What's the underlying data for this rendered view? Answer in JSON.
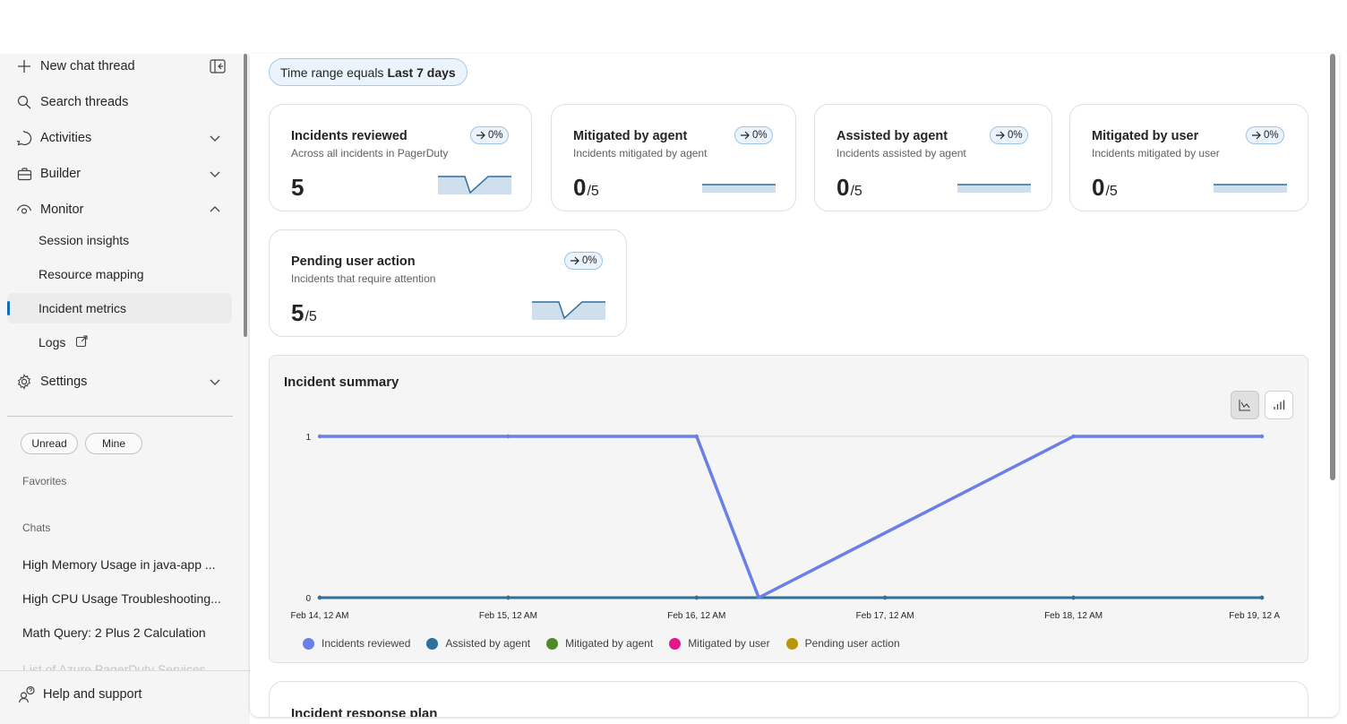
{
  "sidebar": {
    "new_chat": "New chat thread",
    "search": "Search threads",
    "activities": "Activities",
    "builder": "Builder",
    "monitor": "Monitor",
    "monitor_items": [
      "Session insights",
      "Resource mapping",
      "Incident metrics",
      "Logs"
    ],
    "settings": "Settings",
    "filters": [
      "Unread",
      "Mine"
    ],
    "favorites": "Favorites",
    "chats_title": "Chats",
    "chats": [
      "High Memory Usage in java-app ...",
      "High CPU Usage Troubleshooting...",
      "Math Query: 2 Plus 2 Calculation",
      "List of Azure PagerDuty Services"
    ],
    "help": "Help and support"
  },
  "filter": {
    "prefix": "Time range equals",
    "value": "Last 7 days"
  },
  "cards": [
    {
      "title": "Incidents reviewed",
      "subtitle": "Across all incidents in PagerDuty",
      "value": "5",
      "denominator": "",
      "trend": "0%"
    },
    {
      "title": "Mitigated by agent",
      "subtitle": "Incidents mitigated by agent",
      "value": "0",
      "denominator": "/5",
      "trend": "0%"
    },
    {
      "title": "Assisted by agent",
      "subtitle": "Incidents assisted by agent",
      "value": "0",
      "denominator": "/5",
      "trend": "0%"
    },
    {
      "title": "Mitigated by user",
      "subtitle": "Incidents mitigated by user",
      "value": "0",
      "denominator": "/5",
      "trend": "0%"
    },
    {
      "title": "Pending user action",
      "subtitle": "Incidents that require attention",
      "value": "5",
      "denominator": "/5",
      "trend": "0%"
    }
  ],
  "summary": {
    "title": "Incident summary"
  },
  "plan": {
    "title": "Incident response plan"
  },
  "colors": {
    "accent": "#0f6cbd",
    "incidents_reviewed": "#6b7fe8",
    "assisted_by_agent": "#2e6f9e",
    "mitigated_by_agent": "#4e8a2a",
    "mitigated_by_user": "#e3178b",
    "pending_user_action": "#b8960c"
  },
  "chart_data": {
    "type": "line",
    "x": [
      "Feb 14, 12 AM",
      "Feb 15, 12 AM",
      "Feb 16, 12 AM",
      "Feb 16, 8 AM",
      "Feb 17, 12 AM",
      "Feb 18, 12 AM",
      "Feb 19, 12 AM"
    ],
    "x_positions_days": [
      0,
      1,
      2,
      2.33,
      3,
      4,
      5
    ],
    "tick_labels": [
      "Feb 14, 12 AM",
      "Feb 15, 12 AM",
      "Feb 16, 12 AM",
      "Feb 17, 12 AM",
      "Feb 18, 12 AM",
      "Feb 19, 12 A"
    ],
    "yticks": [
      0,
      1
    ],
    "ylim": [
      0,
      1
    ],
    "series": [
      {
        "name": "Incidents reviewed",
        "color": "#6b7fe8",
        "values": [
          1,
          1,
          1,
          0,
          null,
          1,
          1
        ]
      },
      {
        "name": "Assisted by agent",
        "color": "#2e6f9e",
        "values": [
          0,
          0,
          0,
          0,
          0,
          0,
          0
        ]
      },
      {
        "name": "Mitigated by agent",
        "color": "#4e8a2a",
        "values": [
          0,
          0,
          0,
          0,
          0,
          0,
          0
        ]
      },
      {
        "name": "Mitigated by user",
        "color": "#e3178b",
        "values": [
          0,
          0,
          0,
          0,
          0,
          0,
          0
        ]
      },
      {
        "name": "Pending user action",
        "color": "#b8960c",
        "values": [
          0,
          0,
          0,
          0,
          0,
          0,
          0
        ]
      }
    ],
    "grid": true,
    "legend": "bottom-left"
  }
}
